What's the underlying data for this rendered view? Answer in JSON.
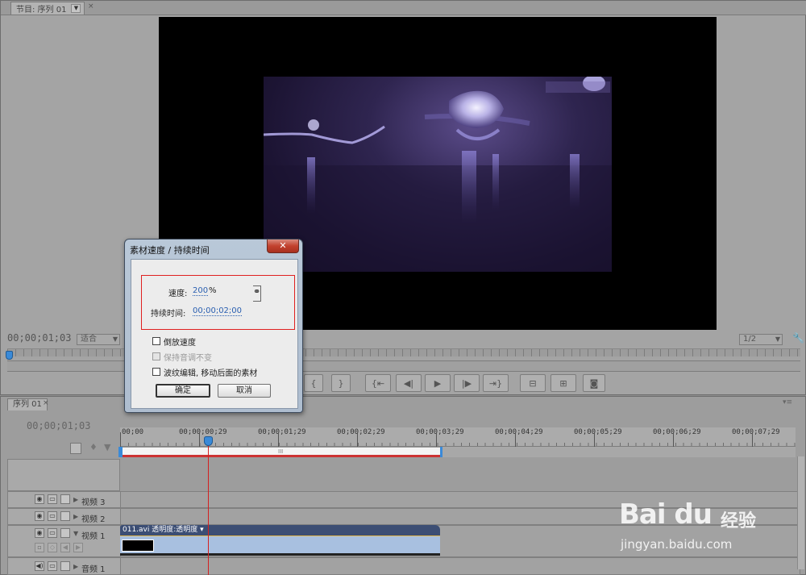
{
  "monitor": {
    "tab_label": "节目: 序列 01",
    "tab_close": "×",
    "timecode": "00;00;01;03",
    "fit_select": "适合",
    "resolution_select": "1/2"
  },
  "timeline": {
    "tab_label": "序列 01",
    "tab_close": "×",
    "timecode": "00;00;01;03",
    "ruler_ticks": [
      "00;00",
      "00;00;00;29",
      "00;00;01;29",
      "00;00;02;29",
      "00;00;03;29",
      "00;00;04;29",
      "00;00;05;29",
      "00;00;06;29",
      "00;00;07;29"
    ],
    "workarea_grip": "III",
    "tracks": [
      {
        "name": "视频 3",
        "expanded": false
      },
      {
        "name": "视频 2",
        "expanded": false
      },
      {
        "name": "视频 1",
        "expanded": true
      },
      {
        "name": "音频 1",
        "expanded": false
      }
    ],
    "clip": {
      "title": "011.avi  透明度:透明度 ▾"
    }
  },
  "dialog": {
    "title": "素材速度 / 持续时间",
    "close_label": "✕",
    "speed_label": "速度:",
    "speed_value": "200",
    "speed_unit": "%",
    "duration_label": "持续时间:",
    "duration_value": "00;00;02;00",
    "options": [
      {
        "label": "倒放速度",
        "checked": false,
        "enabled": true
      },
      {
        "label": "保持音调不变",
        "checked": false,
        "enabled": false
      },
      {
        "label": "波纹编辑, 移动后面的素材",
        "checked": false,
        "enabled": true
      }
    ],
    "ok_label": "确定",
    "cancel_label": "取消"
  },
  "watermark": {
    "logo": "Bai du",
    "cn": "经验",
    "url": "jingyan.baidu.com"
  },
  "colors": {
    "panel_bg": "#a4a4a4",
    "playhead": "#3a8ad8",
    "playhead_line": "#d42020",
    "clip_header": "#3c4e74",
    "clip_body": "#a8c0e0",
    "highlight": "#e02020",
    "dialog_link": "#2a5fb0"
  }
}
